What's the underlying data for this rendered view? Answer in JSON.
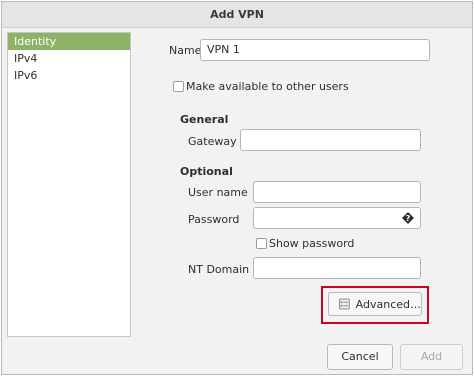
{
  "window": {
    "title": "Add VPN"
  },
  "sidebar": {
    "items": [
      {
        "label": "Identity",
        "selected": true
      },
      {
        "label": "IPv4",
        "selected": false
      },
      {
        "label": "IPv6",
        "selected": false
      }
    ]
  },
  "identity": {
    "name_label": "Name",
    "name_value": "VPN 1",
    "make_available_label": "Make available to other users",
    "make_available_checked": false,
    "general_heading": "General",
    "gateway_label": "Gateway",
    "gateway_value": "",
    "optional_heading": "Optional",
    "username_label": "User name",
    "username_value": "",
    "password_label": "Password",
    "password_value": "",
    "password_icon": "password-storage-icon",
    "show_password_label": "Show password",
    "show_password_checked": false,
    "ntdomain_label": "NT Domain",
    "ntdomain_value": "",
    "advanced_label": "Advanced…",
    "advanced_icon": "settings-sheet-icon"
  },
  "footer": {
    "cancel_label": "Cancel",
    "add_label": "Add"
  },
  "colors": {
    "selection": "#8fb366",
    "highlight": "#d0021b"
  }
}
